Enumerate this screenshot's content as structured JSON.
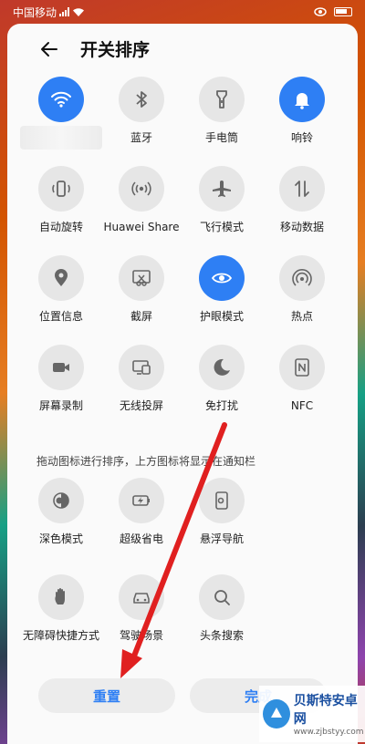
{
  "status": {
    "carrier": "中国移动",
    "signal_icon": "signal-icon",
    "wifi_icon": "wifi-status-icon",
    "eye_icon": "eye-comfort-status-icon",
    "battery_icon": "battery-icon"
  },
  "header": {
    "title": "开关排序",
    "back_icon": "back-arrow-icon"
  },
  "tiles": [
    {
      "label": "",
      "icon": "wifi-icon",
      "active": true
    },
    {
      "label": "蓝牙",
      "icon": "bluetooth-icon",
      "active": false
    },
    {
      "label": "手电筒",
      "icon": "flashlight-icon",
      "active": false
    },
    {
      "label": "响铃",
      "icon": "bell-icon",
      "active": true
    },
    {
      "label": "自动旋转",
      "icon": "auto-rotate-icon",
      "active": false
    },
    {
      "label": "Huawei Share",
      "icon": "huawei-share-icon",
      "active": false
    },
    {
      "label": "飞行模式",
      "icon": "airplane-icon",
      "active": false
    },
    {
      "label": "移动数据",
      "icon": "mobile-data-icon",
      "active": false
    },
    {
      "label": "位置信息",
      "icon": "location-icon",
      "active": false
    },
    {
      "label": "截屏",
      "icon": "screenshot-icon",
      "active": false
    },
    {
      "label": "护眼模式",
      "icon": "eye-comfort-icon",
      "active": true
    },
    {
      "label": "热点",
      "icon": "hotspot-icon",
      "active": false
    },
    {
      "label": "屏幕录制",
      "icon": "screen-record-icon",
      "active": false
    },
    {
      "label": "无线投屏",
      "icon": "wireless-projection-icon",
      "active": false
    },
    {
      "label": "免打扰",
      "icon": "do-not-disturb-icon",
      "active": false
    },
    {
      "label": "NFC",
      "icon": "nfc-icon",
      "active": false
    }
  ],
  "hint": "拖动图标进行排序，上方图标将显示在通知栏",
  "extra_tiles": [
    {
      "label": "深色模式",
      "icon": "dark-mode-icon"
    },
    {
      "label": "超级省电",
      "icon": "super-power-saving-icon"
    },
    {
      "label": "悬浮导航",
      "icon": "floating-navigation-icon"
    },
    {
      "label": "无障碍快捷方式",
      "icon": "accessibility-icon"
    },
    {
      "label": "驾驶场景",
      "icon": "driving-mode-icon"
    },
    {
      "label": "头条搜索",
      "icon": "search-icon"
    }
  ],
  "buttons": {
    "reset": "重置",
    "done": "完成"
  },
  "watermark": {
    "name": "贝斯特安卓网",
    "url": "www.zjbstyy.com"
  },
  "colors": {
    "accent": "#2e7ff4",
    "annotation_arrow": "#e02020"
  }
}
